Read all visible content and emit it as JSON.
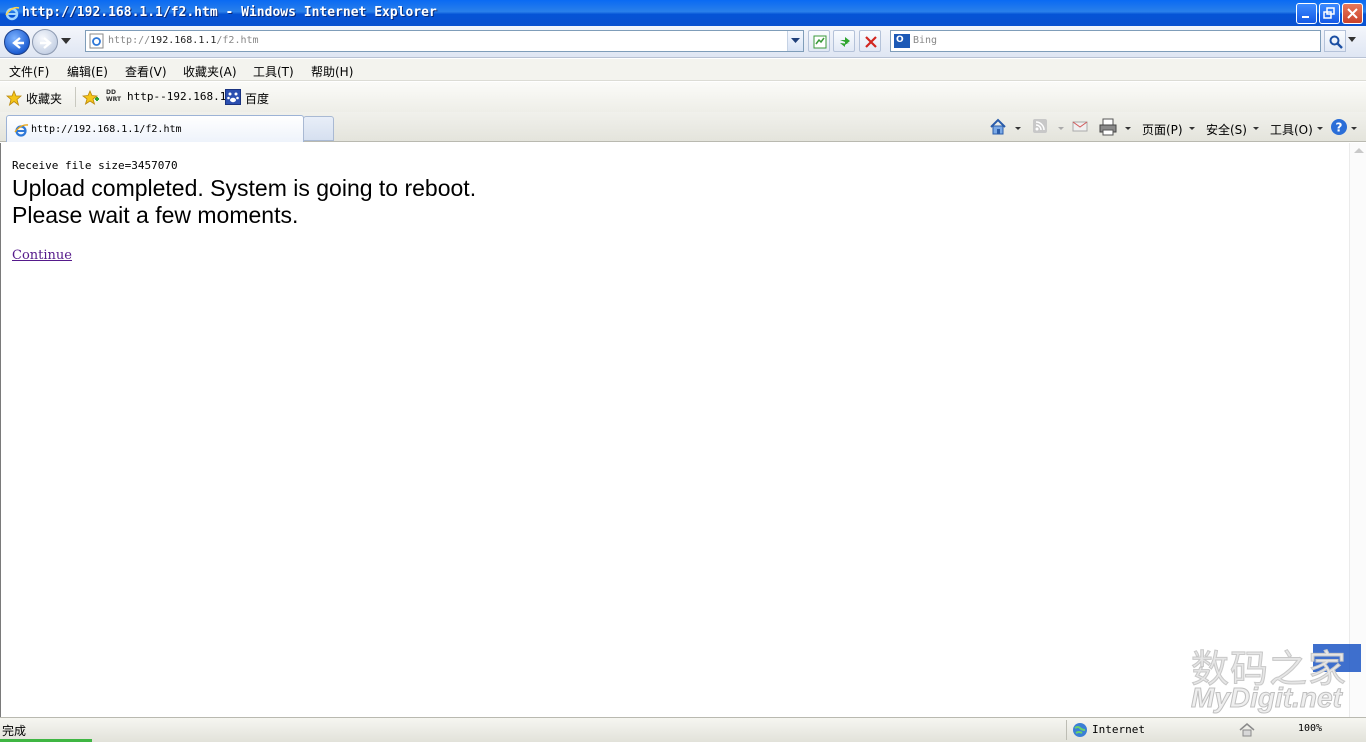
{
  "window": {
    "title": "http://192.168.1.1/f2.htm - Windows Internet Explorer"
  },
  "address_bar": {
    "url_prefix": "http://",
    "url_host": "192.168.1.1",
    "url_path": "/f2.htm",
    "search_placeholder": "Bing"
  },
  "menu": {
    "items": [
      "文件(F)",
      "编辑(E)",
      "查看(V)",
      "收藏夹(A)",
      "工具(T)",
      "帮助(H)"
    ]
  },
  "favorites": {
    "label": "收藏夹",
    "links": [
      "http--192.168.1",
      "百度"
    ]
  },
  "tabs": [
    {
      "title": "http://192.168.1.1/f2.htm"
    }
  ],
  "command_bar": {
    "page": "页面(P)",
    "safety": "安全(S)",
    "tools": "工具(O)"
  },
  "content": {
    "receive": "Receive file size=3457070",
    "line1": "Upload completed.  System is going to reboot.",
    "line2": "Please wait a few moments.",
    "continue_link": "Continue"
  },
  "watermark": {
    "cn": "数码之家",
    "en": "MyDigit.net"
  },
  "status_bar": {
    "status": "完成",
    "zone": "Internet",
    "zoom": "100%"
  },
  "colors": {
    "titlebar": "#0a6af3",
    "visited_link": "#551a8b",
    "progress": "#3fb643"
  }
}
